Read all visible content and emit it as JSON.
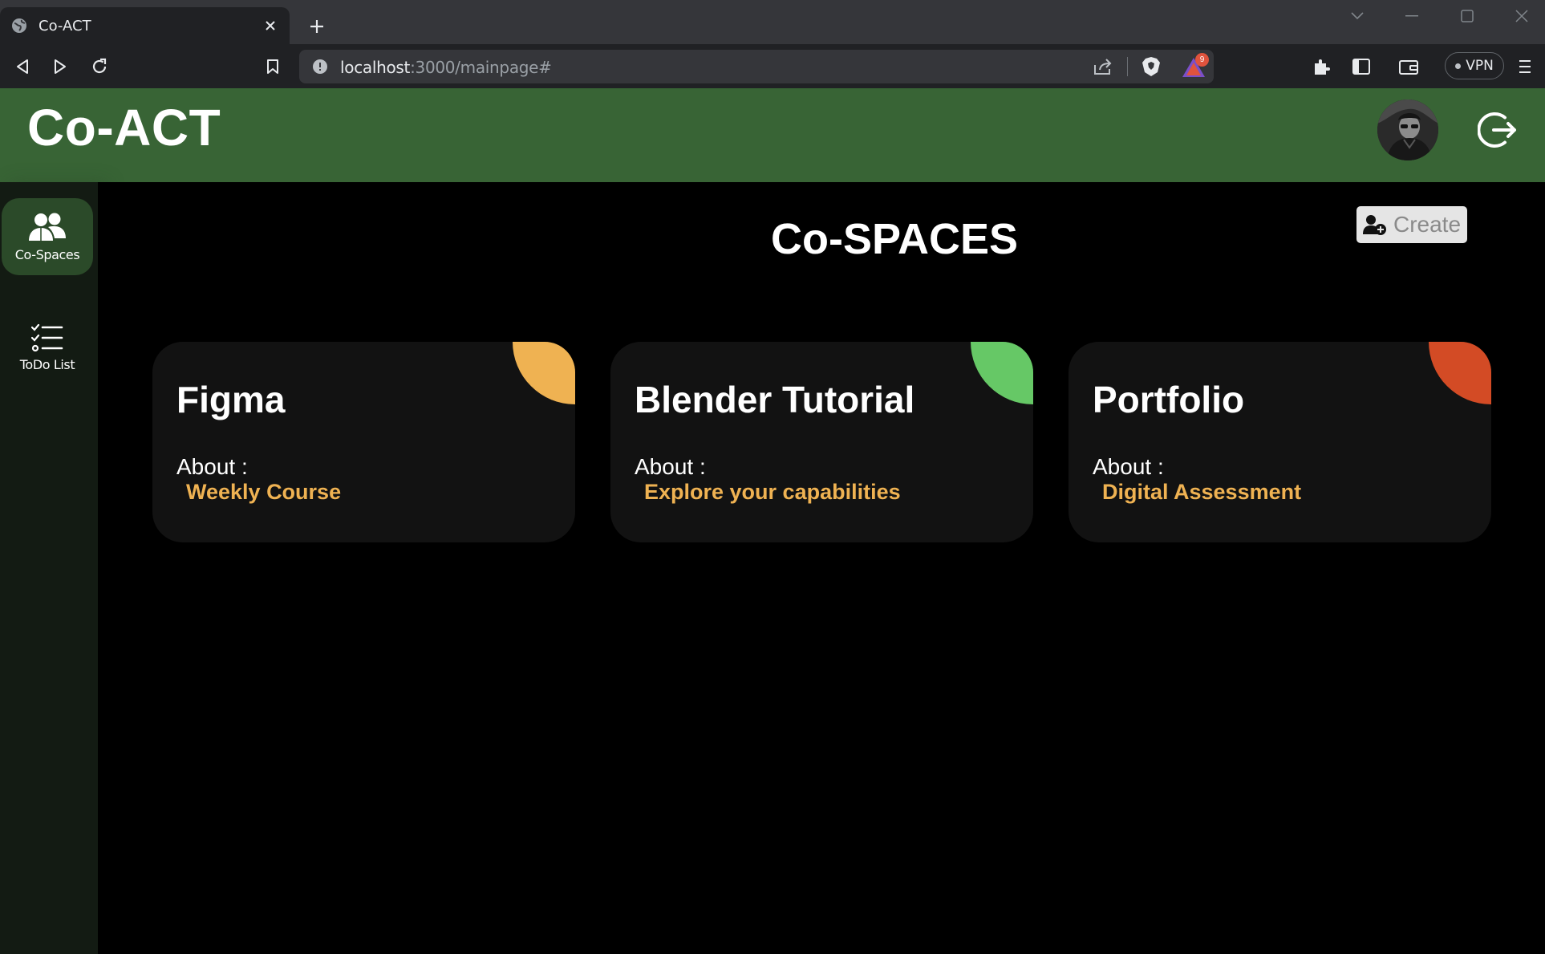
{
  "browser": {
    "tab_title": "Co-ACT",
    "url_host": "localhost",
    "url_path": ":3000/mainpage#",
    "rewards_count": "9",
    "vpn_label": "VPN"
  },
  "header": {
    "logo": "Co-ACT"
  },
  "sidebar": {
    "items": [
      {
        "label": "Co-Spaces",
        "icon": "group-icon",
        "active": true
      },
      {
        "label": "ToDo List",
        "icon": "checklist-icon",
        "active": false
      }
    ]
  },
  "main": {
    "title": "Co-SPACES",
    "create_label": "Create",
    "about_label": "About :",
    "cards": [
      {
        "title": "Figma",
        "about": "Weekly Course",
        "accent": "#efb252"
      },
      {
        "title": "Blender Tutorial",
        "about": "Explore your capabilities",
        "accent": "#66c866"
      },
      {
        "title": "Portfolio",
        "about": "Digital Assessment",
        "accent": "#d34b25"
      }
    ]
  },
  "colors": {
    "header_green": "#386435",
    "sidebar_bg": "#131b13",
    "active_item": "#2b4a29",
    "card_bg": "#121212",
    "about_text": "#efb252"
  }
}
